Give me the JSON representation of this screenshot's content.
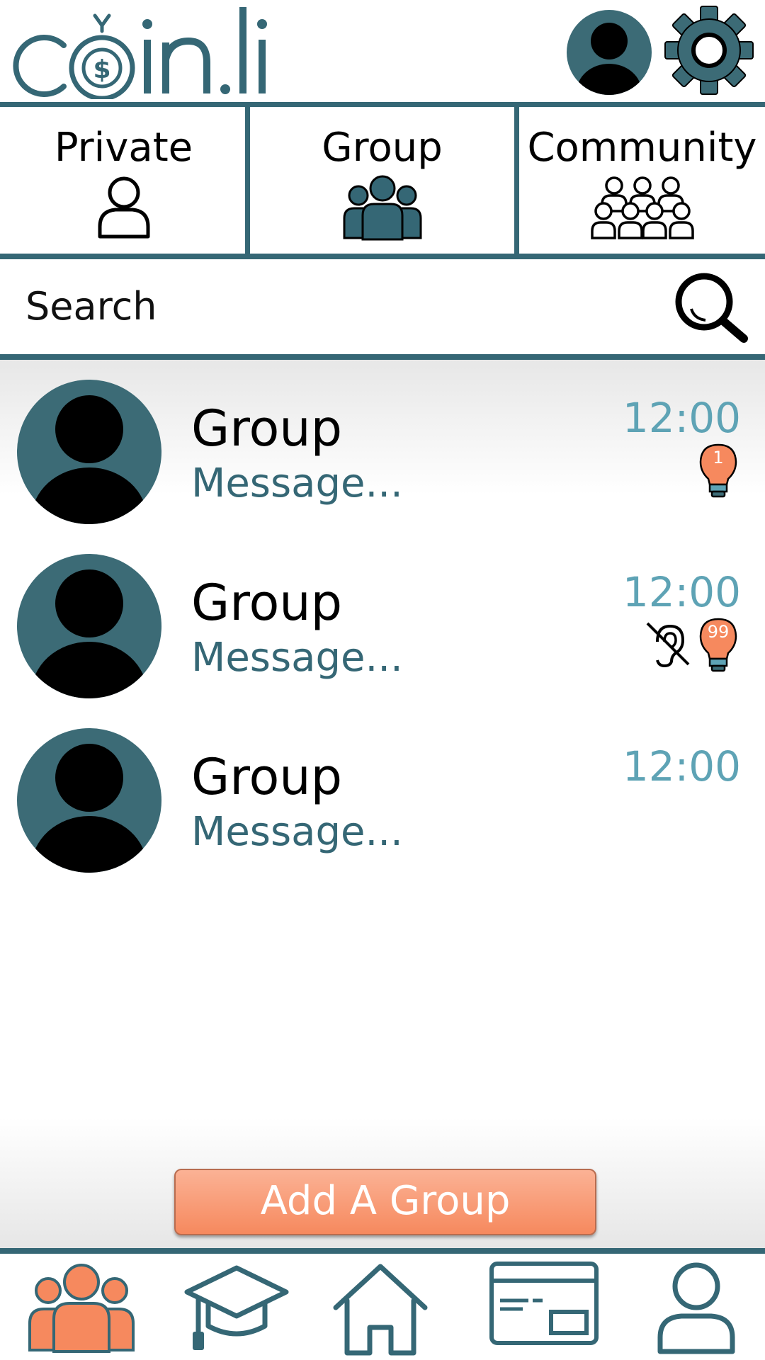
{
  "app": {
    "logo_text": "coin.li",
    "accent_color": "#356775",
    "time_color": "#5ea3b5",
    "notification_color": "#f6895e",
    "header_icons": [
      "profile-avatar",
      "gear-icon"
    ]
  },
  "tabs": [
    {
      "label": "Private",
      "icon": "single-person-outline",
      "active": false
    },
    {
      "label": "Group",
      "icon": "group-filled",
      "active": true
    },
    {
      "label": "Community",
      "icon": "community-outline",
      "active": false
    }
  ],
  "search": {
    "placeholder": "Search",
    "icon": "magnifier-icon"
  },
  "conversations": [
    {
      "title": "Group",
      "message": "Message...",
      "time": "12:00",
      "unread": "1",
      "muted": false
    },
    {
      "title": "Group",
      "message": "Message...",
      "time": "12:00",
      "unread": "99",
      "muted": true
    },
    {
      "title": "Group",
      "message": "Message...",
      "time": "12:00",
      "unread": "",
      "muted": false
    }
  ],
  "add_button": {
    "label": "Add A Group"
  },
  "bottom_nav": [
    {
      "name": "groups",
      "icon": "group-filled-orange",
      "active": true
    },
    {
      "name": "learn",
      "icon": "graduation-cap-icon",
      "active": false
    },
    {
      "name": "home",
      "icon": "house-icon",
      "active": false
    },
    {
      "name": "card",
      "icon": "credit-card-icon",
      "active": false
    },
    {
      "name": "profile",
      "icon": "person-outline-icon",
      "active": false
    }
  ]
}
